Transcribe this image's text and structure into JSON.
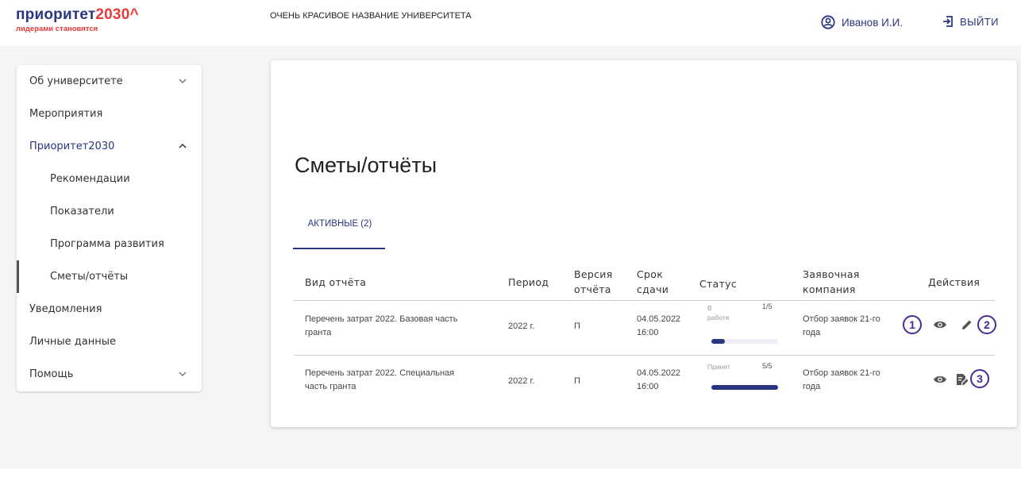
{
  "header": {
    "logo_main": "приоритет",
    "logo_accent": "2030^",
    "logo_sub": "лидерами становятся",
    "university_name": "ОЧЕНЬ КРАСИВОЕ НАЗВАНИЕ УНИВЕРСИТЕТА",
    "user_name": "Иванов И.И.",
    "logout_label": "ВЫЙТИ"
  },
  "sidebar": {
    "items": [
      {
        "label": "Об университете",
        "chevron": "down"
      },
      {
        "label": "Мероприятия"
      },
      {
        "label": "Приоритет2030",
        "chevron": "up"
      },
      {
        "label": "Рекомендации"
      },
      {
        "label": "Показатели"
      },
      {
        "label": "Программа развития"
      },
      {
        "label": "Сметы/отчёты"
      },
      {
        "label": "Уведомления"
      },
      {
        "label": "Личные данные"
      },
      {
        "label": "Помощь",
        "chevron": "down"
      }
    ]
  },
  "main": {
    "title": "Сметы/отчёты",
    "tab_label": "АКТИВНЫЕ (2)",
    "columns": {
      "type": "Вид отчёта",
      "period": "Период",
      "version_1": "Версия",
      "version_2": "отчёта",
      "deadline_1": "Срок",
      "deadline_2": "сдачи",
      "status": "Статус",
      "company_1": "Заявочная",
      "company_2": "компания",
      "actions": "Действия"
    },
    "rows": [
      {
        "type_1": "Перечень затрат 2022. Базовая часть",
        "type_2": "гранта",
        "period": "2022 г.",
        "version": "П",
        "deadline_1": "04.05.2022",
        "deadline_2": "16:00",
        "status_1": "В",
        "status_2": "работе",
        "status_count": "1/5",
        "progress": 0.2,
        "company_1": "Отбор заявок 21-го",
        "company_2": "года"
      },
      {
        "type_1": "Перечень затрат 2022. Специальная",
        "type_2": "часть гранта",
        "period": "2022 г.",
        "version": "П",
        "deadline_1": "04.05.2022",
        "deadline_2": "16:00",
        "status_1": "Принят",
        "status_2": "",
        "status_count": "5/5",
        "progress": 1.0,
        "company_1": "Отбор заявок 21-го",
        "company_2": "года"
      }
    ],
    "annotations": [
      "1",
      "2",
      "3"
    ]
  },
  "colors": {
    "brand": "#2a3580",
    "accent": "#e63a3a",
    "annotation": "#4a2a9a"
  }
}
